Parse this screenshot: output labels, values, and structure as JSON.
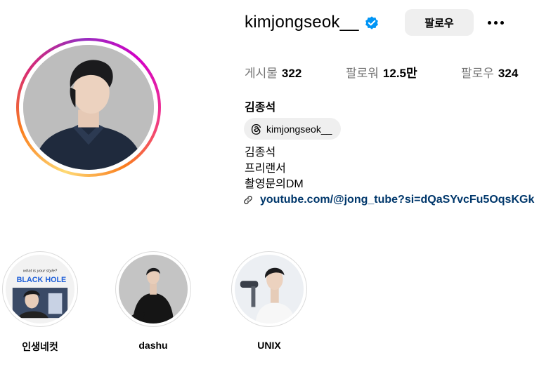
{
  "profile": {
    "username": "kimjongseok__",
    "verified_icon": "verified-badge-icon",
    "follow_label": "팔로우",
    "more_icon": "more-options-icon",
    "stats": {
      "posts_label": "게시물",
      "posts_value": "322",
      "followers_label": "팔로워",
      "followers_value": "12.5만",
      "following_label": "팔로우",
      "following_value": "324"
    },
    "full_name": "김종석",
    "threads_handle": "kimjongseok__",
    "threads_icon": "threads-icon",
    "bio_lines": [
      "김종석",
      "프리랜서",
      "촬영문의DM"
    ],
    "link_icon": "link-icon",
    "link_text": "youtube.com/@jong_tube?si=dQaSYvcFu5OqsKGk"
  },
  "highlights": [
    {
      "label": "인생네컷",
      "cover_text": [
        "what is your style?",
        "BLACK HOLE"
      ]
    },
    {
      "label": "dashu"
    },
    {
      "label": "UNIX"
    }
  ],
  "colors": {
    "accent_link": "#00376b",
    "verified_blue": "#0095f6",
    "button_bg": "#efefef",
    "muted_text": "#737373"
  }
}
